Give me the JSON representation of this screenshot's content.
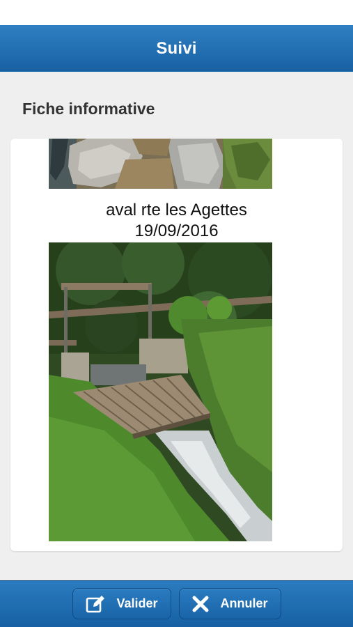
{
  "header": {
    "title": "Suivi"
  },
  "section": {
    "title": "Fiche informative"
  },
  "photo_entry": {
    "location": "aval rte les Agettes",
    "date": "19/09/2016"
  },
  "footer": {
    "valider_label": "Valider",
    "annuler_label": "Annuler",
    "valider_icon": "edit-icon",
    "annuler_icon": "close-icon"
  },
  "colors": {
    "header": "#1f6cb0",
    "background": "#efefef",
    "card": "#ffffff"
  }
}
